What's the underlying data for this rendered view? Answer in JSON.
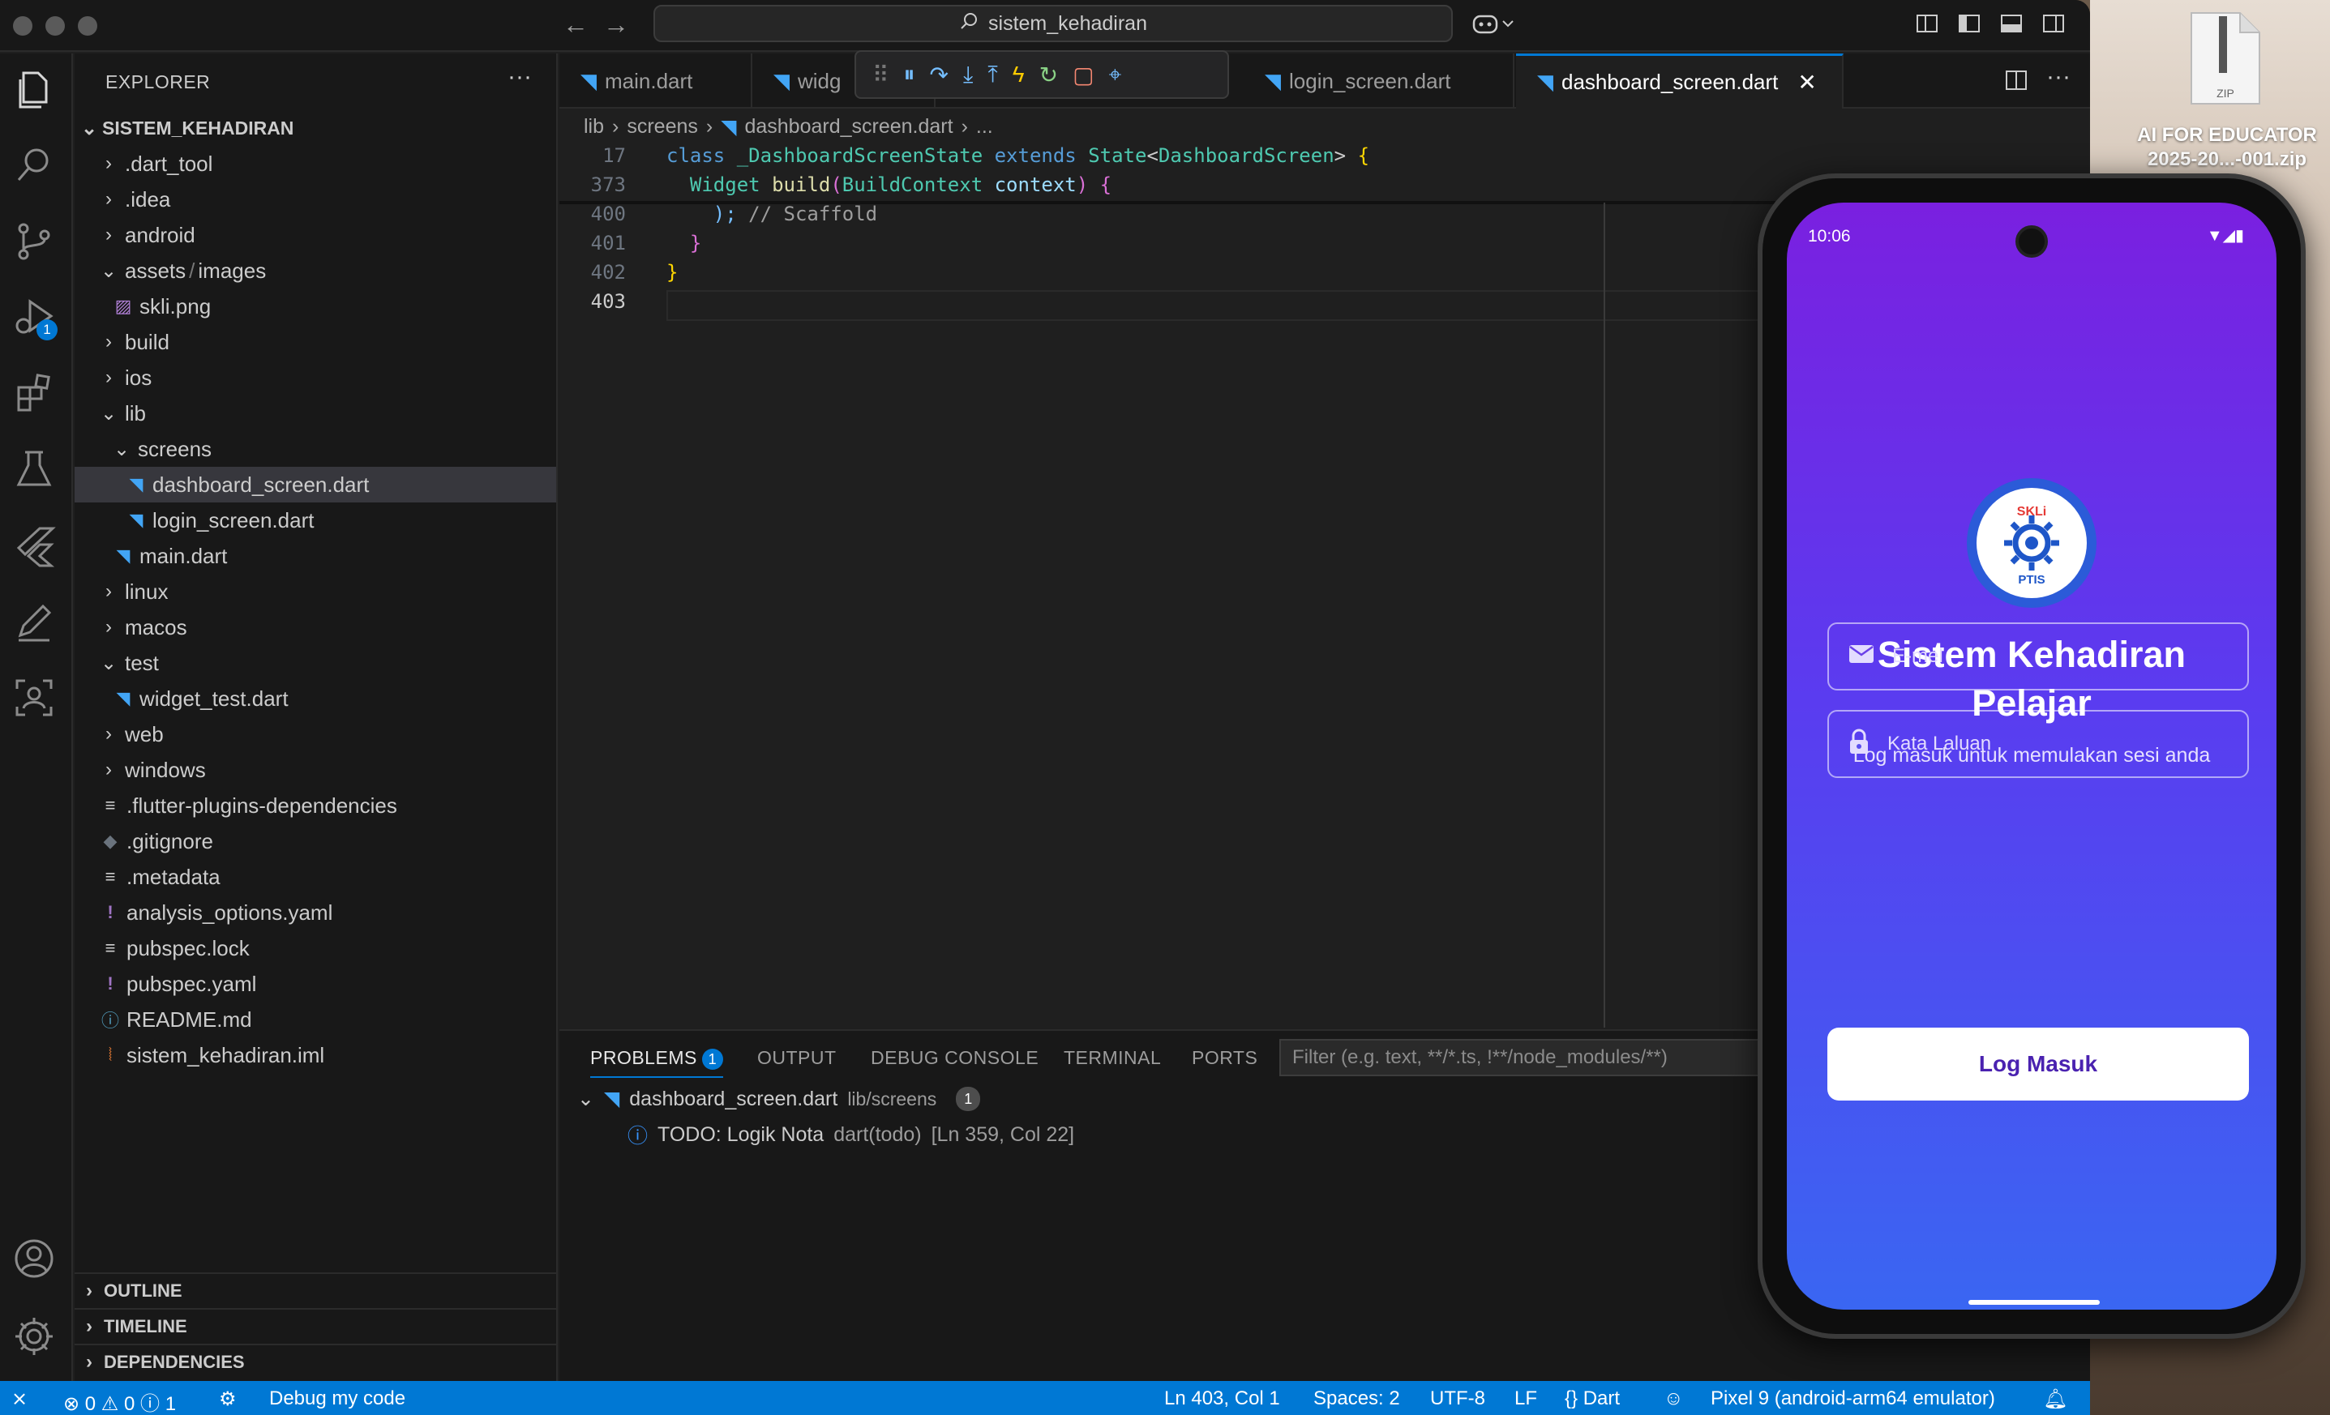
{
  "desktop": {
    "file_label": "AI FOR EDUCATOR 2025-20...-001.zip",
    "file_type": "ZIP"
  },
  "titlebar": {
    "search": "sistem_kehadiran"
  },
  "sidebar": {
    "title": "EXPLORER",
    "more": "···",
    "root": "SISTEM_KEHADIRAN",
    "items": [
      {
        "label": ".dart_tool"
      },
      {
        "label": ".idea"
      },
      {
        "label": "android"
      },
      {
        "label": "assets",
        "sep": "/",
        "label2": "images"
      },
      {
        "label": "skli.png"
      },
      {
        "label": "build"
      },
      {
        "label": "ios"
      },
      {
        "label": "lib"
      },
      {
        "label": "screens"
      },
      {
        "label": "dashboard_screen.dart"
      },
      {
        "label": "login_screen.dart"
      },
      {
        "label": "main.dart"
      },
      {
        "label": "linux"
      },
      {
        "label": "macos"
      },
      {
        "label": "test"
      },
      {
        "label": "widget_test.dart"
      },
      {
        "label": "web"
      },
      {
        "label": "windows"
      },
      {
        "label": ".flutter-plugins-dependencies"
      },
      {
        "label": ".gitignore"
      },
      {
        "label": ".metadata"
      },
      {
        "label": "analysis_options.yaml"
      },
      {
        "label": "pubspec.lock"
      },
      {
        "label": "pubspec.yaml"
      },
      {
        "label": "README.md"
      },
      {
        "label": "sistem_kehadiran.iml"
      }
    ],
    "sections": [
      "OUTLINE",
      "TIMELINE",
      "DEPENDENCIES"
    ]
  },
  "activity": {
    "debug_badge": "1"
  },
  "tabs": [
    {
      "label": "main.dart"
    },
    {
      "label": "widg"
    },
    {
      "label": "login_screen.dart"
    },
    {
      "label": "dashboard_screen.dart"
    }
  ],
  "breadcrumb": [
    "lib",
    "screens",
    "dashboard_screen.dart",
    "..."
  ],
  "code": {
    "lines": [
      "17",
      "373",
      "400",
      "401",
      "402",
      "403"
    ],
    "l17": {
      "kw": "class",
      "cls": "_DashboardScreenState",
      "ext": "extends",
      "sup": "State",
      "lt": "<",
      "gen": "DashboardScreen",
      "gt": ">",
      "br": "{"
    },
    "l373": {
      "ty": "Widget",
      "fn": "build",
      "op": "(",
      "ty2": "BuildContext",
      "pr": "context",
      "cp": ")",
      "br": "{"
    },
    "l400": {
      "code": "); ",
      "cm": "// Scaffold"
    },
    "l401": "}",
    "l402": "}"
  },
  "panel": {
    "tabs": [
      "PROBLEMS",
      "OUTPUT",
      "DEBUG CONSOLE",
      "TERMINAL",
      "PORTS"
    ],
    "problems_count": "1",
    "filter_placeholder": "Filter (e.g. text, **/*.ts, !**/node_modules/**)",
    "file": "dashboard_screen.dart",
    "path": "lib/screens",
    "file_count": "1",
    "issue": "TODO: Logik Nota",
    "source": "dart(todo)",
    "location": "[Ln 359, Col 22]"
  },
  "status": {
    "errors": "0",
    "warnings": "0",
    "infos": "1",
    "debug": "Debug my code",
    "position": "Ln 403, Col 1",
    "spaces": "Spaces: 2",
    "encoding": "UTF-8",
    "eol": "LF",
    "language": "Dart",
    "device": "Pixel 9 (android-arm64 emulator)"
  },
  "phone": {
    "time": "10:06",
    "logo_top": "SKLi",
    "logo_bottom": "PTIS",
    "title_line1": "Sistem Kehadiran",
    "title_line2": "Pelajar",
    "subtitle": "Log masuk untuk memulakan sesi anda",
    "email_placeholder": "E-mel",
    "password_placeholder": "Kata Laluan",
    "login_button": "Log Masuk"
  },
  "colors": {
    "accent": "#0078d4",
    "phone_top": "#7a20e0",
    "phone_bottom": "#3a66f2"
  }
}
